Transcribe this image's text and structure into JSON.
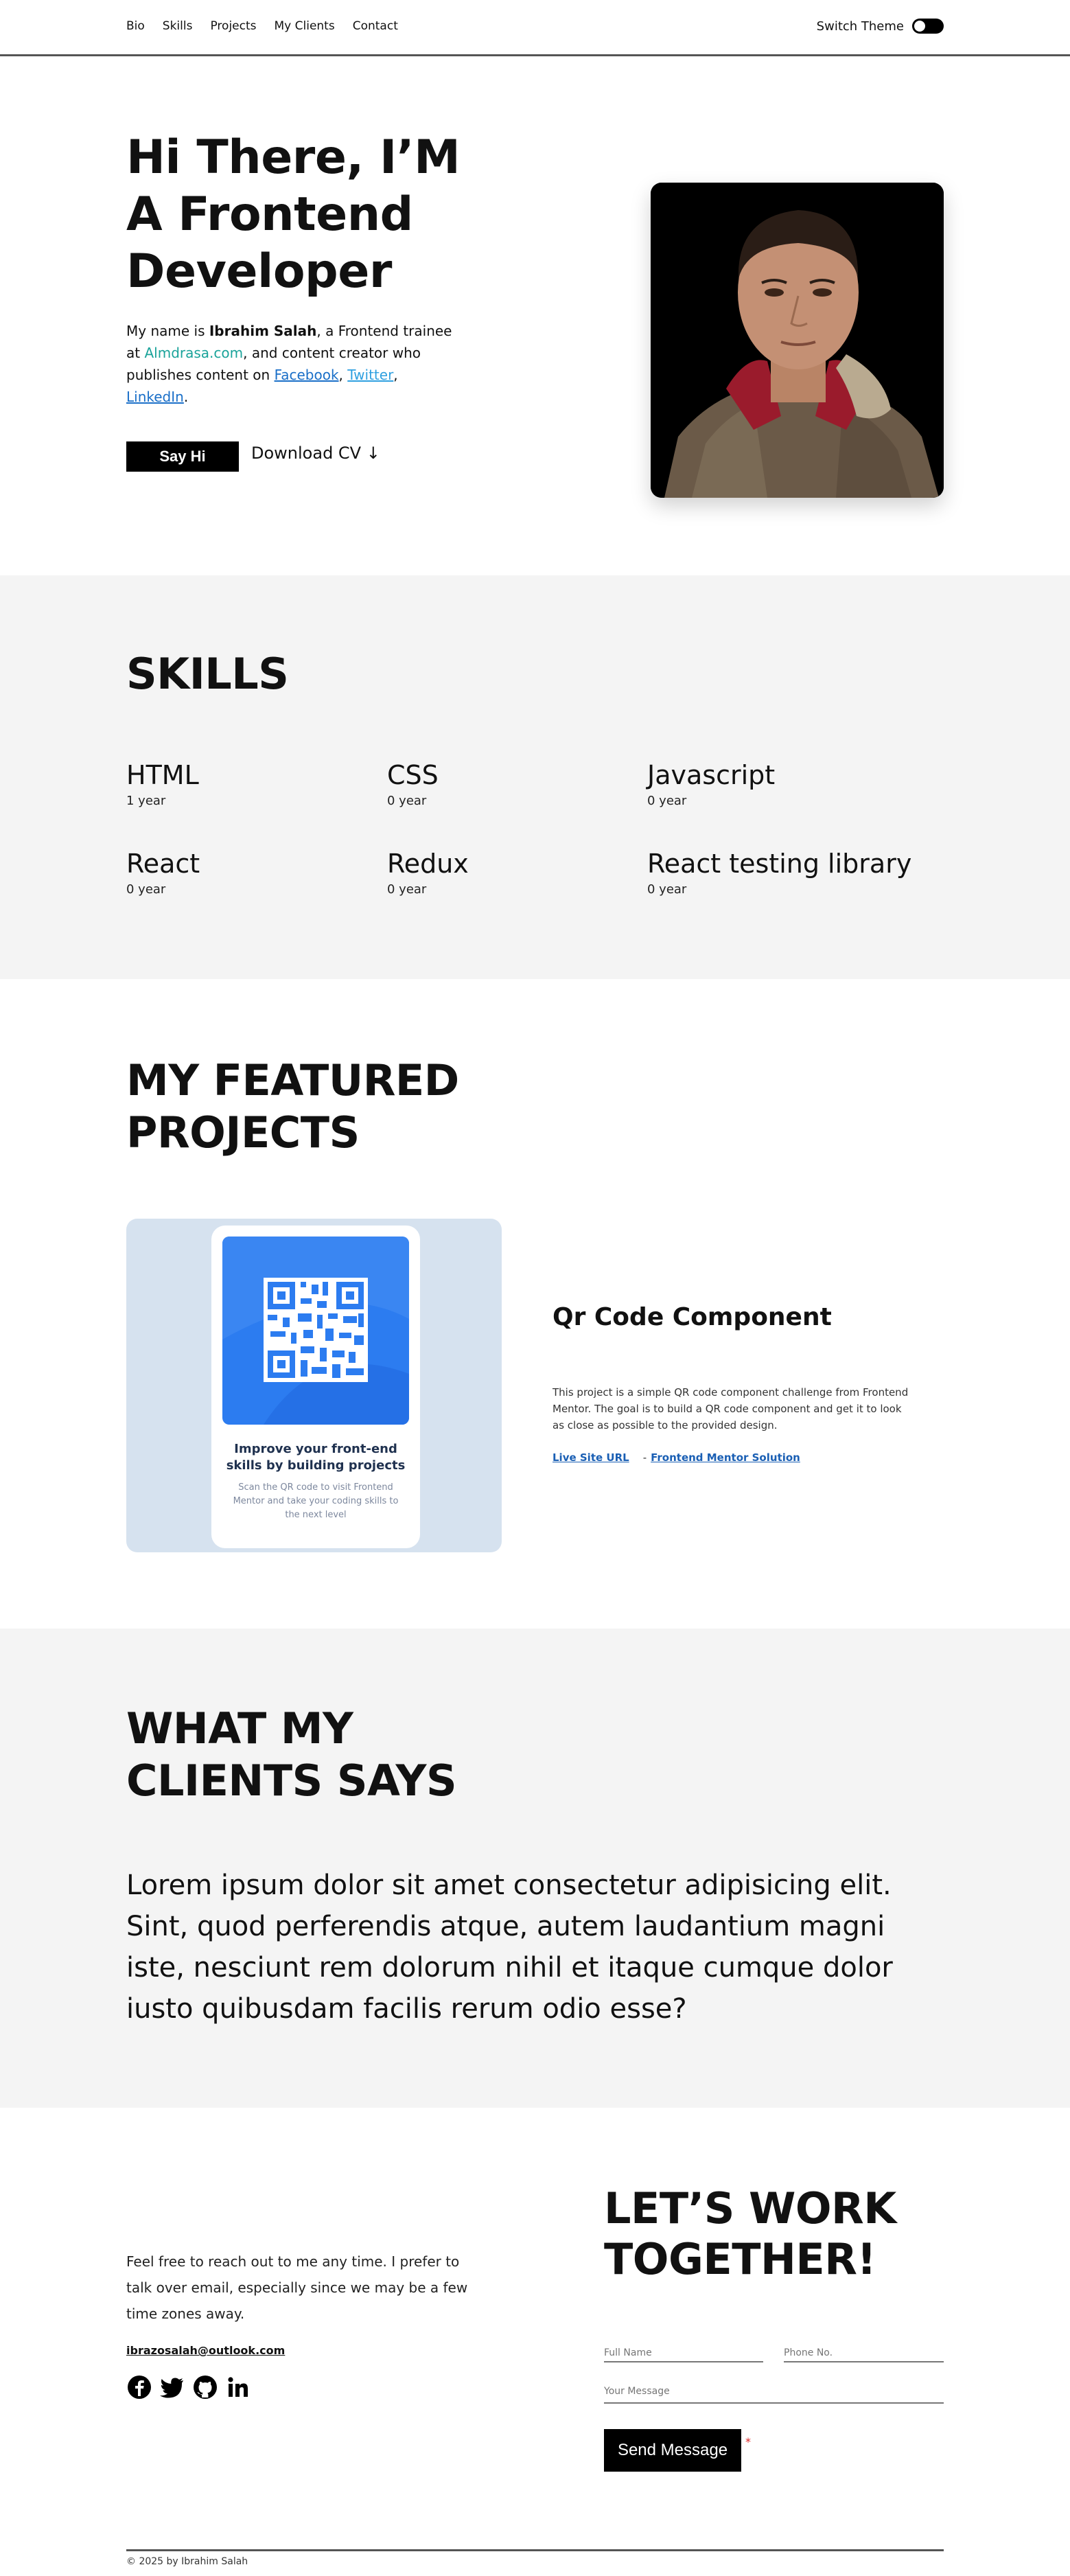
{
  "nav": {
    "links": [
      "Bio",
      "Skills",
      "Projects",
      "My Clients",
      "Contact"
    ],
    "theme_label": "Switch Theme"
  },
  "hero": {
    "title": "Hi There, I’M A Frontend Developer",
    "desc_prefix": "My name is ",
    "name": "Ibrahim Salah",
    "desc_mid1": ", a Frontend trainee at ",
    "company": "Almdrasa.com",
    "desc_mid2": ", and content creator who publishes content on ",
    "facebook": "Facebook",
    "twitter": "Twitter",
    "linkedin": "LinkedIn",
    "say_hi": "Say Hi",
    "download_cv": "Download CV ↓"
  },
  "skills": {
    "title": "SKILLS",
    "items": [
      {
        "name": "HTML",
        "years": "1 year"
      },
      {
        "name": "CSS",
        "years": "0 year"
      },
      {
        "name": "Javascript",
        "years": "0 year"
      },
      {
        "name": "React",
        "years": "0 year"
      },
      {
        "name": "Redux",
        "years": "0 year"
      },
      {
        "name": "React testing library",
        "years": "0 year"
      }
    ]
  },
  "projects": {
    "title": "MY FEATURED PROJECTS",
    "item": {
      "name": "Qr Code Component",
      "description": "This project is a simple QR code component challenge from Frontend Mentor. The goal is to build a QR code component and get it to look as close as possible to the provided design.",
      "live_label": "Live Site URL",
      "separator": "-",
      "solution_label": "Frontend Mentor Solution",
      "preview_title": "Improve your front-end skills by building projects",
      "preview_sub": "Scan the QR code to visit Frontend Mentor and take your coding skills to the next level"
    }
  },
  "clients": {
    "title": "WHAT MY CLIENTS SAYS",
    "quote": "Lorem ipsum dolor sit amet consectetur adipisicing elit. Sint, quod perferendis atque, autem laudantium magni iste, nesciunt rem dolorum nihil et itaque cumque dolor iusto quibusdam facilis rerum odio esse?"
  },
  "contact": {
    "text": "Feel free to reach out to me any time. I prefer to talk over email, especially since we may be a few time zones away.",
    "email": "ibrazosalah@outlook.com",
    "title": "LET’S WORK TOGETHER!",
    "full_name_placeholder": "Full Name",
    "phone_placeholder": "Phone No.",
    "message_placeholder": "Your Message",
    "send_label": "Send Message",
    "required_mark": "*"
  },
  "footer": {
    "copyright": "© 2025 by Ibrahim Salah"
  }
}
